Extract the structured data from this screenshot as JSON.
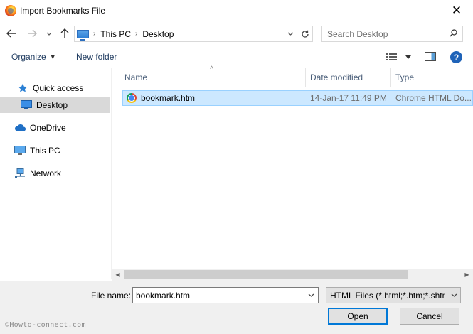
{
  "window": {
    "title": "Import Bookmarks File",
    "close_glyph": "✕"
  },
  "address": {
    "crumbs": [
      "This PC",
      "Desktop"
    ],
    "search_placeholder": "Search Desktop"
  },
  "toolbar": {
    "organize_label": "Organize",
    "new_folder_label": "New folder",
    "help_label": "?"
  },
  "sidebar": {
    "items": [
      {
        "label": "Quick access",
        "icon": "star-icon",
        "selected": false
      },
      {
        "label": "Desktop",
        "icon": "desktop-icon",
        "selected": true
      },
      {
        "label": "OneDrive",
        "icon": "cloud-icon",
        "selected": false
      },
      {
        "label": "This PC",
        "icon": "computer-icon",
        "selected": false
      },
      {
        "label": "Network",
        "icon": "network-icon",
        "selected": false
      }
    ]
  },
  "columns": {
    "name": "Name",
    "date": "Date modified",
    "type": "Type"
  },
  "files": [
    {
      "name": "bookmark.htm",
      "date": "14-Jan-17 11:49 PM",
      "type": "Chrome HTML Do...",
      "icon": "chrome-icon",
      "selected": true
    }
  ],
  "footer": {
    "file_name_label": "File name:",
    "file_name_value": "bookmark.htm",
    "filter_value": "HTML Files (*.html;*.htm;*.shtml)",
    "open_label": "Open",
    "cancel_label": "Cancel",
    "watermark": "©Howto-connect.com"
  },
  "colors": {
    "selection": "#cce8ff",
    "selection_border": "#99d1ff",
    "sidebar_selected": "#d9d9d9",
    "accent": "#0078d7"
  }
}
